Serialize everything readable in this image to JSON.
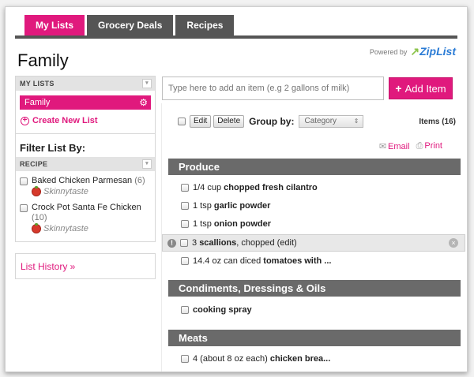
{
  "tabs": [
    {
      "label": "My Lists",
      "active": true
    },
    {
      "label": "Grocery Deals",
      "active": false
    },
    {
      "label": "Recipes",
      "active": false
    }
  ],
  "page_title": "Family",
  "powered_by": {
    "text": "Powered by",
    "brand": "ZipList"
  },
  "colors": {
    "accent": "#e0197d",
    "section": "#6a6a6a",
    "tab": "#555555"
  },
  "sidebar": {
    "my_lists_header": "MY LISTS",
    "lists": [
      {
        "label": "Family",
        "selected": true
      }
    ],
    "create_new": "Create New List",
    "filter_title": "Filter List By:",
    "recipe_header": "RECIPE",
    "recipes": [
      {
        "name": "Baked Chicken Parmesan",
        "count": "(6)",
        "source": "Skinnytaste"
      },
      {
        "name": "Crock Pot Santa Fe Chicken",
        "count": "(10)",
        "source": "Skinnytaste"
      }
    ],
    "history": "List History »"
  },
  "main": {
    "add_placeholder": "Type here to add an item (e.g 2 gallons of milk)",
    "add_button": "Add Item",
    "edit": "Edit",
    "delete": "Delete",
    "group_by": "Group by:",
    "group_value": "Category",
    "items_count": "Items (16)",
    "email": "Email",
    "print": "Print",
    "sections": [
      {
        "name": "Produce",
        "items": [
          {
            "qty": "1/4 cup",
            "name": "chopped fresh cilantro",
            "suffix": ""
          },
          {
            "qty": "1 tsp",
            "name": "garlic powder",
            "suffix": ""
          },
          {
            "qty": "1 tsp",
            "name": "onion powder",
            "suffix": ""
          },
          {
            "qty": "3",
            "name": "scallions",
            "suffix": ", chopped (edit)"
          },
          {
            "qty": "14.4 oz can diced",
            "name": "tomatoes with ...",
            "suffix": ""
          }
        ]
      },
      {
        "name": "Condiments, Dressings & Oils",
        "items": [
          {
            "qty": "",
            "name": "cooking spray",
            "suffix": ""
          }
        ]
      },
      {
        "name": "Meats",
        "items": [
          {
            "qty": "4 (about 8 oz each)",
            "name": "chicken brea...",
            "suffix": ""
          }
        ]
      }
    ]
  }
}
